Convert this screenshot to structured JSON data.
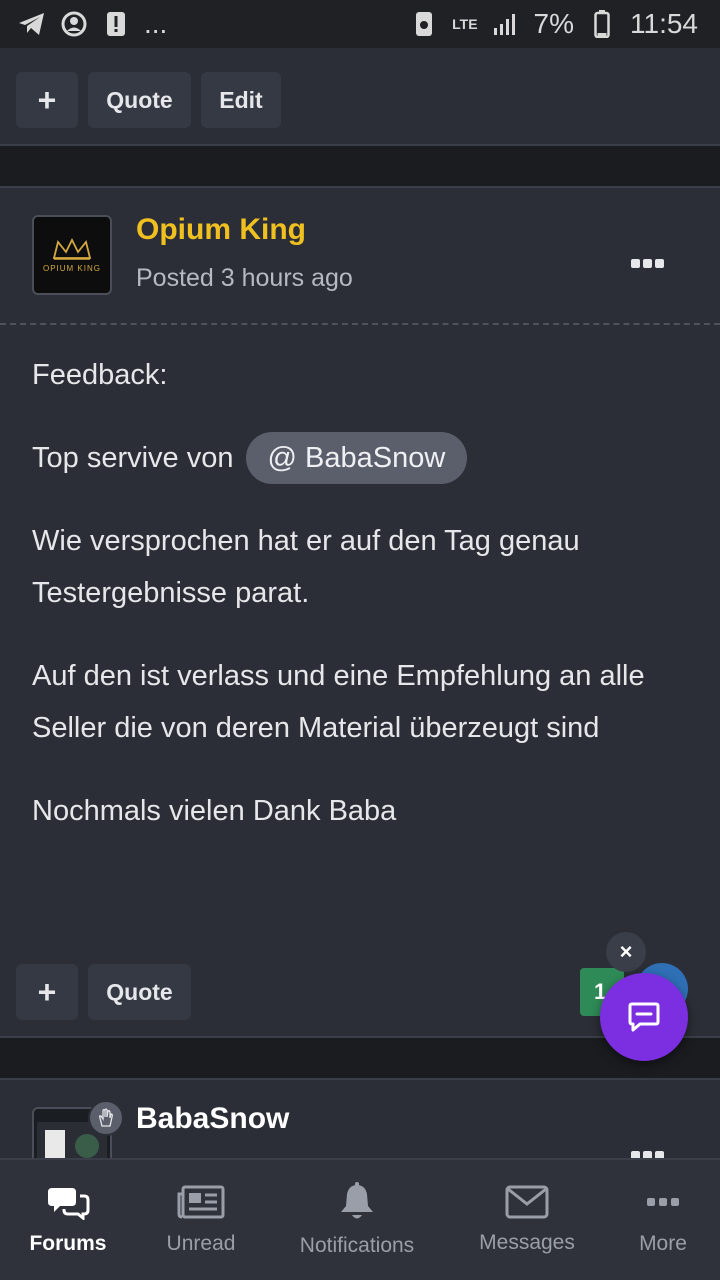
{
  "statusbar": {
    "battery": "7%",
    "time": "11:54",
    "network": "LTE",
    "more": "..."
  },
  "post_prev": {
    "plus_label": "+",
    "quote_label": "Quote",
    "edit_label": "Edit"
  },
  "post_main": {
    "author": "Opium King",
    "posted": "Posted 3 hours ago",
    "avatar_text": "OPIUM KING",
    "paragraphs": {
      "p1": "Feedback:",
      "p2_prefix": "Top servive von ",
      "mention": "@ BabaSnow",
      "p3": "Wie versprochen hat er auf den Tag genau Testergebnisse parat.",
      "p4": "Auf den ist verlass und eine Empfehlung an alle Seller die von deren Material überzeugt sind",
      "p5": "Nochmals vielen Dank Baba"
    },
    "plus_label": "+",
    "quote_label": "Quote",
    "reaction_count": "1",
    "author_color": "#f0c020"
  },
  "post_next": {
    "author": "BabaSnow"
  },
  "fab": {
    "close_label": "×",
    "accent": "#7b2fe0"
  },
  "bottom_nav": {
    "forums": "Forums",
    "unread": "Unread",
    "notifications": "Notifications",
    "messages": "Messages",
    "more": "More"
  }
}
